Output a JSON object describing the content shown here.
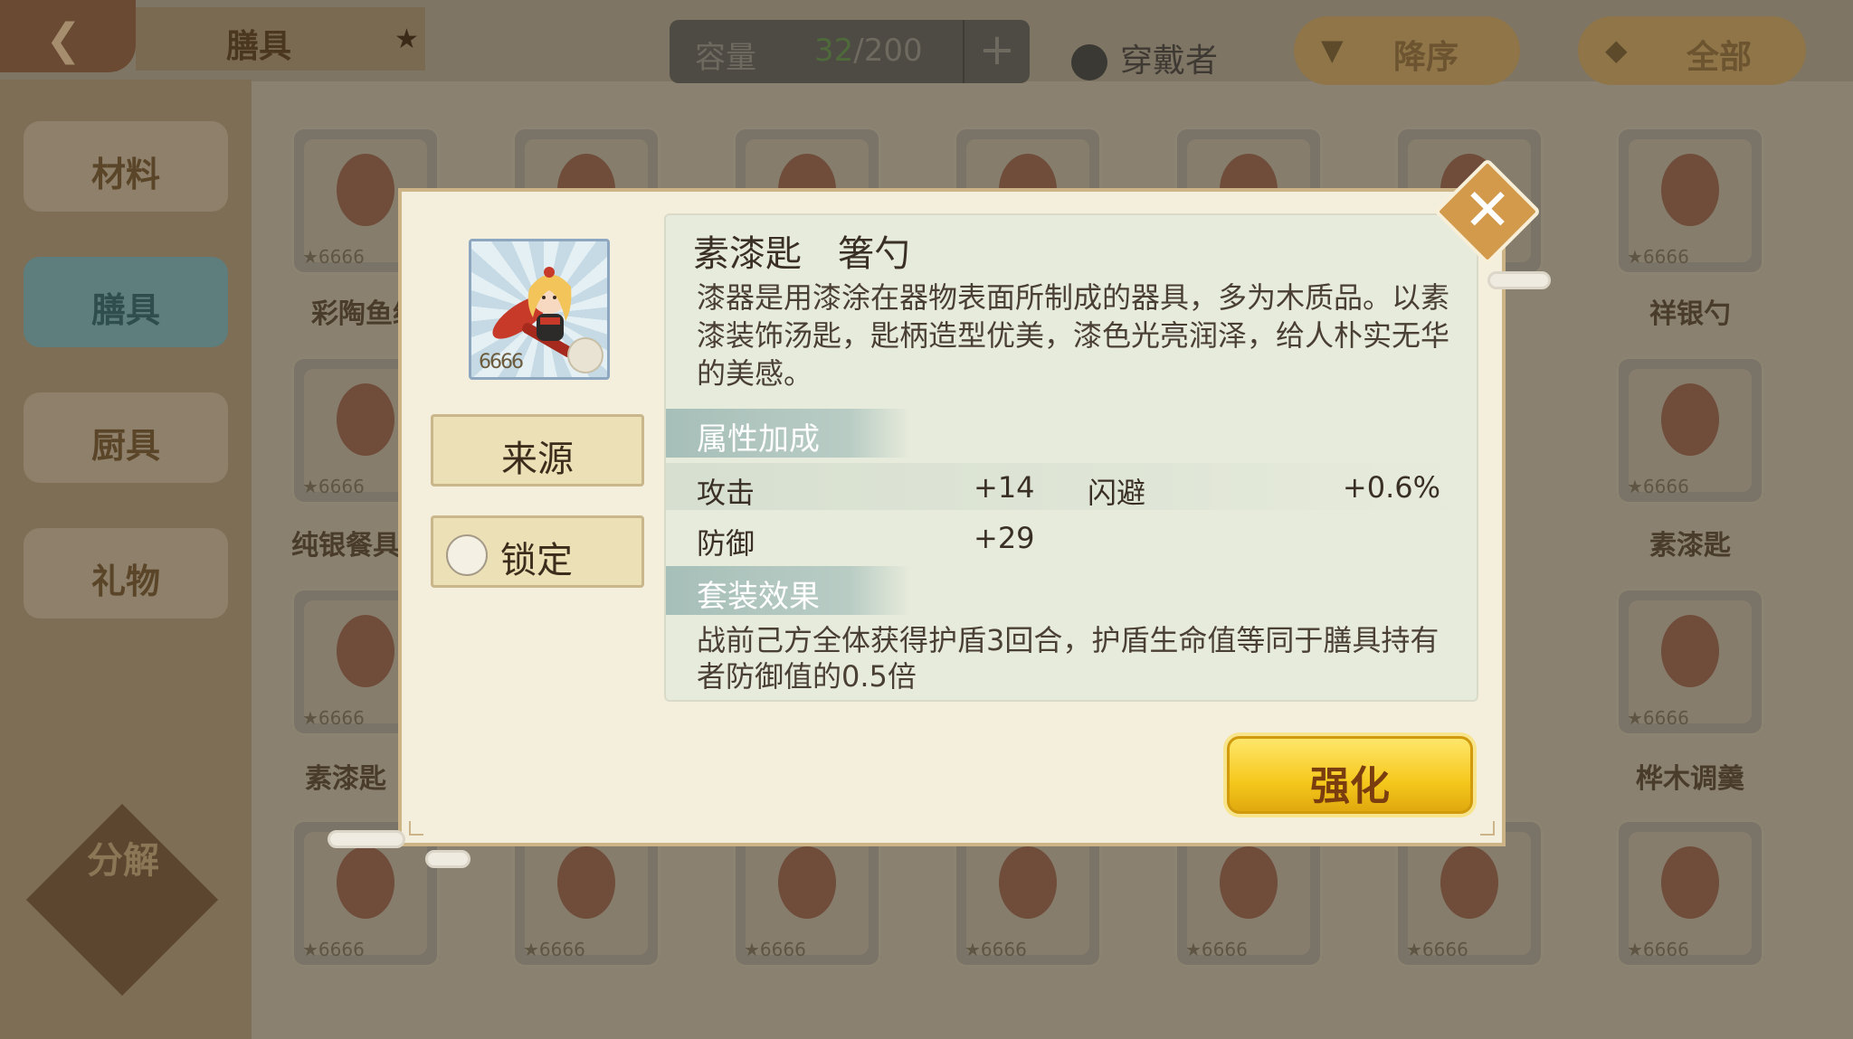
{
  "topbar": {
    "back_icon": "back-arrow-icon",
    "title": "膳具",
    "star_icon": "star-icon",
    "capacity_label": "容量",
    "capacity_current": "32",
    "capacity_total": "/200",
    "add_icon": "plus-icon",
    "wearer_label": "穿戴者",
    "sort_label": "降序",
    "filter_label": "全部"
  },
  "sidebar": {
    "items": [
      {
        "label": "材料"
      },
      {
        "label": "膳具"
      },
      {
        "label": "厨具"
      },
      {
        "label": "礼物"
      }
    ],
    "decompose_label": "分解"
  },
  "grid": {
    "names": [
      "彩陶鱼纹",
      "",
      "",
      "",
      "",
      "",
      "祥银勺",
      "纯银餐具",
      "",
      "",
      "",
      "",
      "",
      "素漆匙",
      "素漆匙",
      "",
      "",
      "",
      "",
      "",
      "桦木调羹"
    ]
  },
  "modal": {
    "item_name": "素漆匙",
    "item_type": "箸勺",
    "item_stars": "6666",
    "description": "漆器是用漆涂在器物表面所制成的器具，多为木质品。以素漆装饰汤匙，匙柄造型优美，漆色光亮润泽，给人朴实无华的美感。",
    "source_label": "来源",
    "lock_label": "锁定",
    "attr_header": "属性加成",
    "stats": [
      {
        "name": "攻击",
        "value": "+14"
      },
      {
        "name": "闪避",
        "value": "+0.6%"
      },
      {
        "name": "防御",
        "value": "+29"
      }
    ],
    "set_header": "套装效果",
    "set_effect": "战前己方全体获得护盾3回合，护盾生命值等同于膳具持有者防御值的0.5倍",
    "enhance_label": "强化",
    "close_icon": "close-icon"
  },
  "colors": {
    "accent_yellow": "#f5c81c",
    "section_header": "#a7bfb9",
    "modal_bg": "#f4efdd"
  }
}
